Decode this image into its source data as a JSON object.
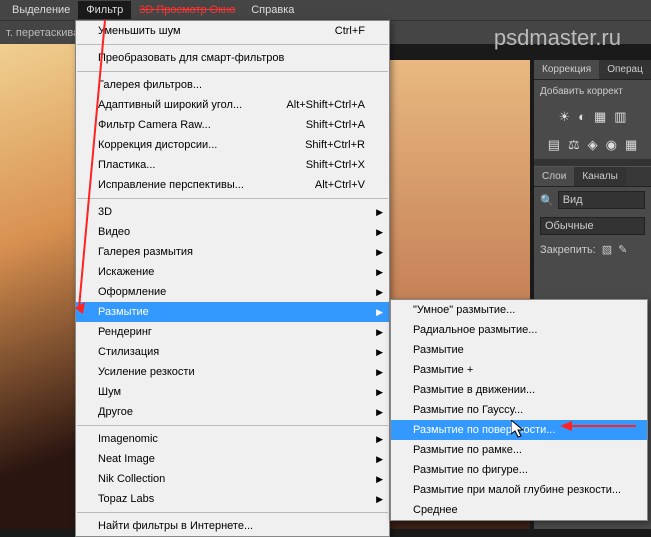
{
  "menubar": {
    "items": [
      "Выделение",
      "Фильтр",
      "3D",
      "Просмотр",
      "Окно",
      "Справка"
    ],
    "active_index": 1,
    "strikethrough": "3D     Просмотр     Окно"
  },
  "optbar": {
    "text": "т. перетаскива"
  },
  "watermark": "psdmaster.ru",
  "menu1": {
    "sections": [
      [
        {
          "label": "Уменьшить шум",
          "shortcut": "Ctrl+F"
        }
      ],
      [
        {
          "label": "Преобразовать для смарт-фильтров"
        }
      ],
      [
        {
          "label": "Галерея фильтров..."
        },
        {
          "label": "Адаптивный широкий угол...",
          "shortcut": "Alt+Shift+Ctrl+A"
        },
        {
          "label": "Фильтр Camera Raw...",
          "shortcut": "Shift+Ctrl+A"
        },
        {
          "label": "Коррекция дисторсии...",
          "shortcut": "Shift+Ctrl+R"
        },
        {
          "label": "Пластика...",
          "shortcut": "Shift+Ctrl+X"
        },
        {
          "label": "Исправление перспективы...",
          "shortcut": "Alt+Ctrl+V"
        }
      ],
      [
        {
          "label": "3D",
          "submenu": true
        },
        {
          "label": "Видео",
          "submenu": true
        },
        {
          "label": "Галерея размытия",
          "submenu": true
        },
        {
          "label": "Искажение",
          "submenu": true
        },
        {
          "label": "Оформление",
          "submenu": true
        },
        {
          "label": "Размытие",
          "submenu": true,
          "highlighted": true
        },
        {
          "label": "Рендеринг",
          "submenu": true
        },
        {
          "label": "Стилизация",
          "submenu": true
        },
        {
          "label": "Усиление резкости",
          "submenu": true
        },
        {
          "label": "Шум",
          "submenu": true
        },
        {
          "label": "Другое",
          "submenu": true
        }
      ],
      [
        {
          "label": "Imagenomic",
          "submenu": true
        },
        {
          "label": "Neat Image",
          "submenu": true
        },
        {
          "label": "Nik Collection",
          "submenu": true
        },
        {
          "label": "Topaz Labs",
          "submenu": true
        }
      ],
      [
        {
          "label": "Найти фильтры в Интернете..."
        }
      ]
    ]
  },
  "menu2": {
    "items": [
      {
        "label": "\"Умное\" размытие..."
      },
      {
        "label": "Радиальное размытие..."
      },
      {
        "label": "Размытие"
      },
      {
        "label": "Размытие +"
      },
      {
        "label": "Размытие в движении..."
      },
      {
        "label": "Размытие по Гауссу..."
      },
      {
        "label": "Размытие по поверхности...",
        "highlighted": true
      },
      {
        "label": "Размытие по рамке..."
      },
      {
        "label": "Размытие по фигуре..."
      },
      {
        "label": "Размытие при малой глубине резкости..."
      },
      {
        "label": "Среднее"
      }
    ]
  },
  "panels": {
    "corrections_tab": "Коррекция",
    "operations_tab": "Операц",
    "add_correction": "Добавить коррект",
    "layers_tab": "Слои",
    "channels_tab": "Каналы",
    "view_label": "Вид",
    "blend_mode": "Обычные",
    "lock_label": "Закрепить:",
    "icons_row1": [
      "☀",
      "◐",
      "▦",
      "▥"
    ],
    "icons_row2": [
      "▤",
      "⚖",
      "◈",
      "◉",
      "▦"
    ]
  }
}
